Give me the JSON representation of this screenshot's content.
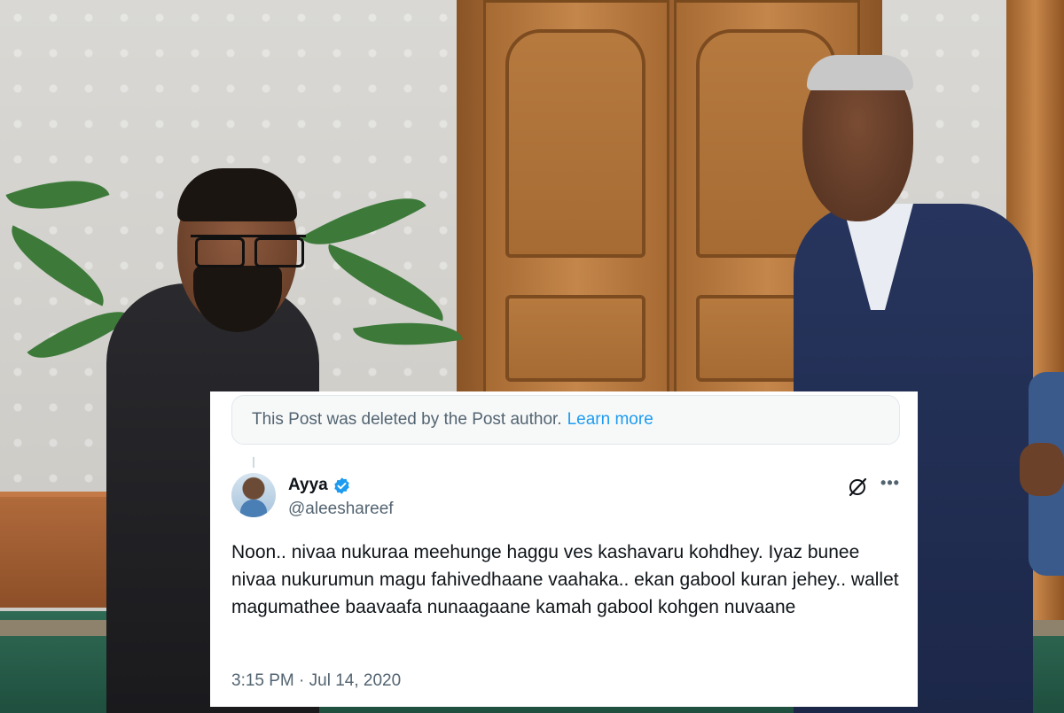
{
  "deleted_notice": {
    "text": "This Post was deleted by the Post author.",
    "link_label": "Learn more"
  },
  "tweet": {
    "display_name": "Ayya",
    "handle": "@aleeshareef",
    "verified": true,
    "text": "Noon.. nivaa nukuraa meehunge haggu ves kashavaru kohdhey. Iyaz bunee nivaa nukurumun magu fahivedhaane vaahaka.. ekan gabool kuran jehey.. wallet magumathee baavaafa nunaagaane kamah gabool kohgen nuvaane",
    "timestamp": "3:15 PM · Jul 14, 2020"
  },
  "icons": {
    "verified": "verified-badge-icon",
    "grok": "grok-icon",
    "more": "more-options-icon",
    "avatar": "avatar"
  },
  "colors": {
    "link": "#1d9bf0",
    "text": "#0f1419",
    "muted": "#536471",
    "notice_bg": "#f7f9f9"
  }
}
